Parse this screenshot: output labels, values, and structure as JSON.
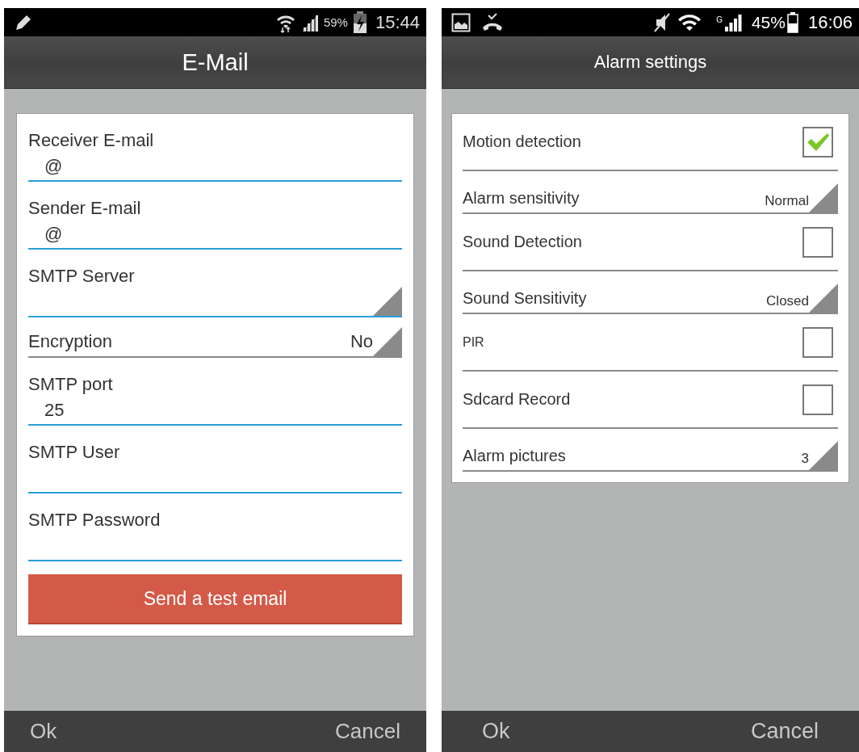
{
  "email_screen": {
    "status_bar": {
      "battery": "59%",
      "time": "15:44"
    },
    "title": "E-Mail",
    "fields": [
      {
        "kind": "text",
        "label": "Receiver E-mail",
        "value": "@"
      },
      {
        "kind": "text",
        "label": "Sender E-mail",
        "value": "@"
      },
      {
        "kind": "dropdown",
        "label": "SMTP Server"
      },
      {
        "kind": "select",
        "label": "Encryption",
        "value": "No"
      },
      {
        "kind": "text",
        "label": "SMTP port",
        "value": "25"
      },
      {
        "kind": "text",
        "label": "SMTP User"
      },
      {
        "kind": "text",
        "label": "SMTP Password"
      }
    ],
    "action_button": "Send a test email",
    "bottom_bar": [
      "Ok",
      "Cancel"
    ]
  },
  "alarm_screen": {
    "status_bar": {
      "network": "G",
      "battery": "45%",
      "time": "16:06"
    },
    "title": "Alarm settings",
    "rows": [
      {
        "kind": "checkbox",
        "label": "Motion detection",
        "checked": true
      },
      {
        "kind": "select",
        "label": "Alarm sensitivity",
        "value": "Normal"
      },
      {
        "kind": "checkbox",
        "label": "Sound Detection",
        "checked": false
      },
      {
        "kind": "select",
        "label": "Sound Sensitivity",
        "value": "Closed"
      },
      {
        "kind": "checkbox",
        "label": "PIR",
        "checked": false,
        "small": true
      },
      {
        "kind": "checkbox",
        "label": "Sdcard Record",
        "checked": false
      },
      {
        "kind": "select",
        "label": "Alarm pictures",
        "value": "3"
      }
    ],
    "bottom_bar": [
      "Ok",
      "Cancel"
    ]
  }
}
